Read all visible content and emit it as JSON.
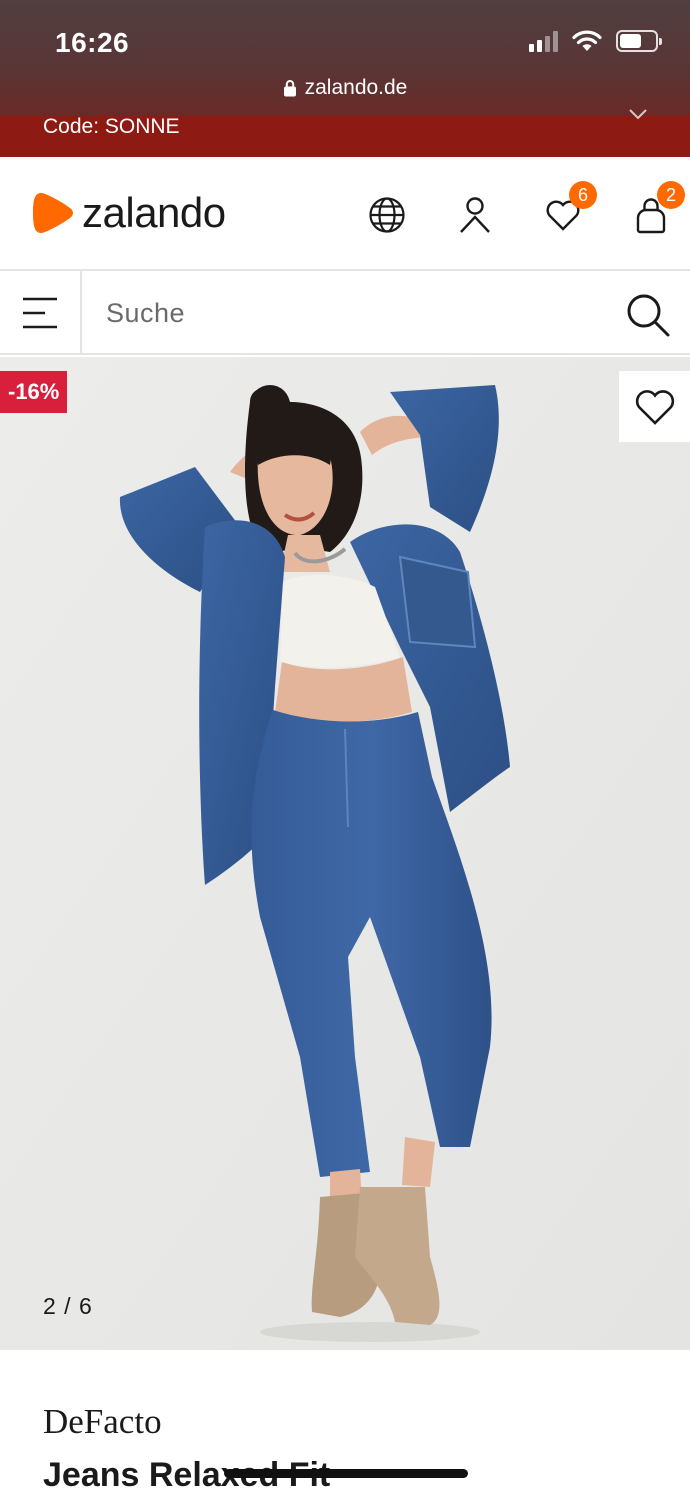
{
  "status_bar": {
    "time": "16:26",
    "icons": [
      "signal-icon",
      "wifi-icon",
      "battery-icon"
    ]
  },
  "browser": {
    "url": "zalando.de",
    "lock_icon": "lock-icon"
  },
  "promo": {
    "text": "Code: SONNE",
    "close_icon": "close-icon",
    "background": "#8e1a14"
  },
  "header": {
    "logo_text": "zalando",
    "logo_color": "#ff6900",
    "icons": [
      "globe-icon",
      "account-icon",
      "wishlist-icon",
      "bag-icon"
    ],
    "wishlist_count": "6",
    "bag_count": "2",
    "badge_color": "#ff6900"
  },
  "search": {
    "placeholder": "Suche",
    "menu_icon": "menu-icon",
    "search_icon": "search-icon"
  },
  "product_gallery": {
    "discount_badge": "-16%",
    "discount_color": "#d8203c",
    "wishlist_icon": "heart-icon",
    "image_counter": "2 / 6"
  },
  "product": {
    "brand": "DeFacto",
    "name": "Jeans Relaxed Fit"
  }
}
